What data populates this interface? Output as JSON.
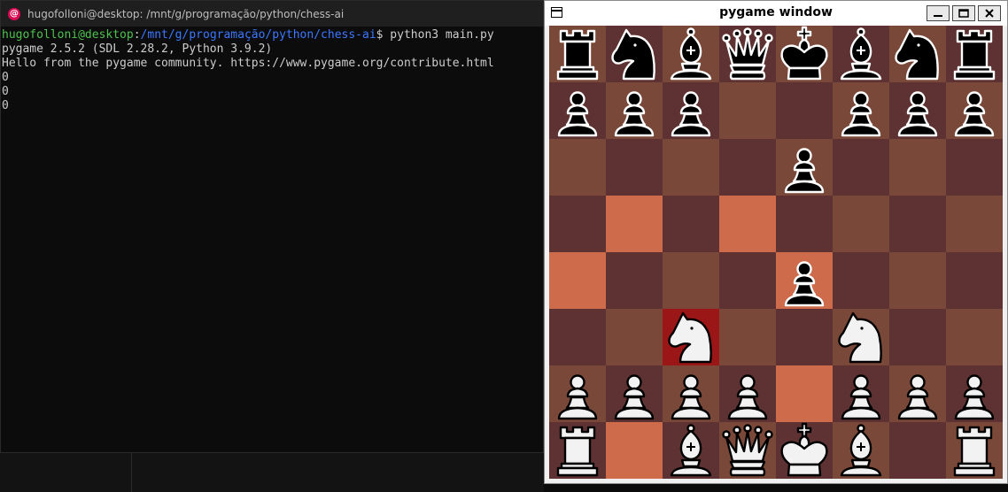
{
  "terminal": {
    "title": "hugofolloni@desktop: /mnt/g/programação/python/chess-ai",
    "prompt_user": "hugofolloni@desktop",
    "prompt_sep": ":",
    "prompt_path": "/mnt/g/programação/python/chess-ai",
    "prompt_cmd": "$ python3 main.py",
    "lines": [
      "pygame 2.5.2 (SDL 2.28.2, Python 3.9.2)",
      "Hello from the pygame community. https://www.pygame.org/contribute.html",
      "0",
      "0",
      "0"
    ]
  },
  "pygame": {
    "title": "pygame window",
    "controls": {
      "minimize": "minimize",
      "maximize": "maximize",
      "close": "close"
    },
    "board": [
      [
        "r",
        "n",
        "b",
        "q",
        "k",
        "b",
        "n",
        "r"
      ],
      [
        "p",
        "p",
        "p",
        "",
        "",
        "p",
        "p",
        "p"
      ],
      [
        "",
        "",
        "",
        "",
        "p",
        "",
        "",
        ""
      ],
      [
        "",
        "",
        "",
        "",
        "",
        "",
        "",
        ""
      ],
      [
        "",
        "",
        "",
        "",
        "p",
        "",
        "",
        ""
      ],
      [
        "",
        "",
        "N",
        "",
        "",
        "N",
        "",
        ""
      ],
      [
        "P",
        "P",
        "P",
        "P",
        "",
        "P",
        "P",
        "P"
      ],
      [
        "R",
        "",
        "B",
        "Q",
        "K",
        "B",
        "",
        "R"
      ]
    ],
    "square_colors": [
      [
        "#7a4838",
        "#5e3232",
        "#7a4838",
        "#5e3232",
        "#7a4838",
        "#5e3232",
        "#7a4838",
        "#5e3232"
      ],
      [
        "#5e3232",
        "#7a4838",
        "#5e3232",
        "#7a4838",
        "#5e3232",
        "#7a4838",
        "#5e3232",
        "#7a4838"
      ],
      [
        "#7a4838",
        "#5e3232",
        "#7a4838",
        "#5e3232",
        "#7a4838",
        "#5e3232",
        "#7a4838",
        "#5e3232"
      ],
      [
        "#5e3232",
        "#cd6b4b",
        "#5e3232",
        "#cd6b4b",
        "#5e3232",
        "#7a4838",
        "#5e3232",
        "#7a4838"
      ],
      [
        "#cd6b4b",
        "#5e3232",
        "#7a4838",
        "#5e3232",
        "#cd6b4b",
        "#5e3232",
        "#7a4838",
        "#5e3232"
      ],
      [
        "#5e3232",
        "#7a4838",
        "#9b1616",
        "#7a4838",
        "#5e3232",
        "#7a4838",
        "#5e3232",
        "#7a4838"
      ],
      [
        "#7a4838",
        "#5e3232",
        "#7a4838",
        "#5e3232",
        "#cd6b4b",
        "#5e3232",
        "#7a4838",
        "#5e3232"
      ],
      [
        "#5e3232",
        "#cd6b4b",
        "#5e3232",
        "#7a4838",
        "#5e3232",
        "#7a4838",
        "#5e3232",
        "#7a4838"
      ]
    ],
    "piece_names": {
      "p": "black-pawn-icon",
      "r": "black-rook-icon",
      "n": "black-knight-icon",
      "b": "black-bishop-icon",
      "q": "black-queen-icon",
      "k": "black-king-icon",
      "P": "white-pawn-icon",
      "R": "white-rook-icon",
      "N": "white-knight-icon",
      "B": "white-bishop-icon",
      "Q": "white-queen-icon",
      "K": "white-king-icon"
    }
  }
}
